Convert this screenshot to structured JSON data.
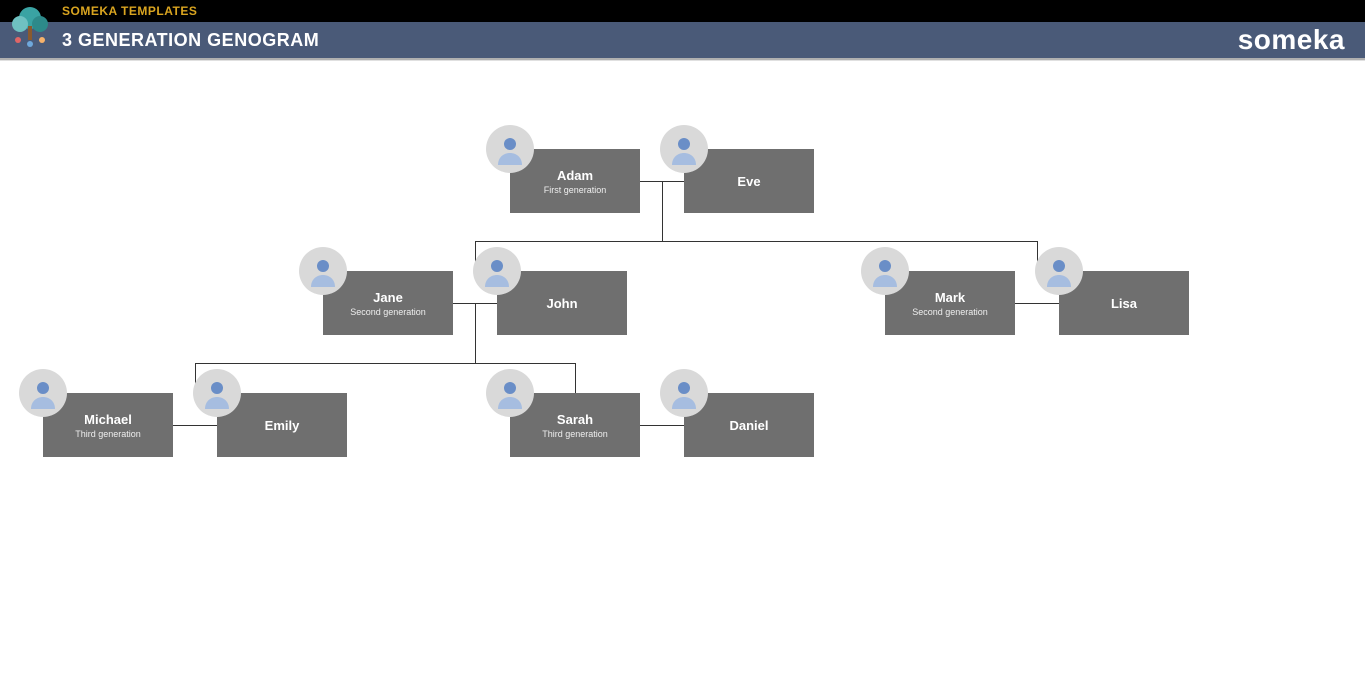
{
  "header": {
    "top_label": "SOMEKA TEMPLATES",
    "title": "3 GENERATION GENOGRAM",
    "brand": "someka"
  },
  "nodes": {
    "adam": {
      "name": "Adam",
      "sub": "First generation"
    },
    "eve": {
      "name": "Eve",
      "sub": ""
    },
    "jane": {
      "name": "Jane",
      "sub": "Second generation"
    },
    "john": {
      "name": "John",
      "sub": ""
    },
    "mark": {
      "name": "Mark",
      "sub": "Second generation"
    },
    "lisa": {
      "name": "Lisa",
      "sub": ""
    },
    "michael": {
      "name": "Michael",
      "sub": "Third generation"
    },
    "emily": {
      "name": "Emily",
      "sub": ""
    },
    "sarah": {
      "name": "Sarah",
      "sub": "Third generation"
    },
    "daniel": {
      "name": "Daniel",
      "sub": ""
    }
  },
  "chart_data": {
    "type": "genogram",
    "generations": [
      {
        "level": 1,
        "label": "First generation",
        "members": [
          "Adam",
          "Eve"
        ]
      },
      {
        "level": 2,
        "label": "Second generation",
        "members": [
          "Jane",
          "John",
          "Mark",
          "Lisa"
        ]
      },
      {
        "level": 3,
        "label": "Third generation",
        "members": [
          "Michael",
          "Emily",
          "Sarah",
          "Daniel"
        ]
      }
    ],
    "couples": [
      [
        "Adam",
        "Eve"
      ],
      [
        "Jane",
        "John"
      ],
      [
        "Mark",
        "Lisa"
      ],
      [
        "Michael",
        "Emily"
      ],
      [
        "Sarah",
        "Daniel"
      ]
    ],
    "parent_child": [
      {
        "parents": [
          "Adam",
          "Eve"
        ],
        "children_couples": [
          [
            "Jane",
            "John"
          ],
          [
            "Mark",
            "Lisa"
          ]
        ]
      },
      {
        "parents": [
          "Jane",
          "John"
        ],
        "children_couples": [
          [
            "Michael",
            "Emily"
          ],
          [
            "Sarah",
            "Daniel"
          ]
        ]
      }
    ]
  }
}
